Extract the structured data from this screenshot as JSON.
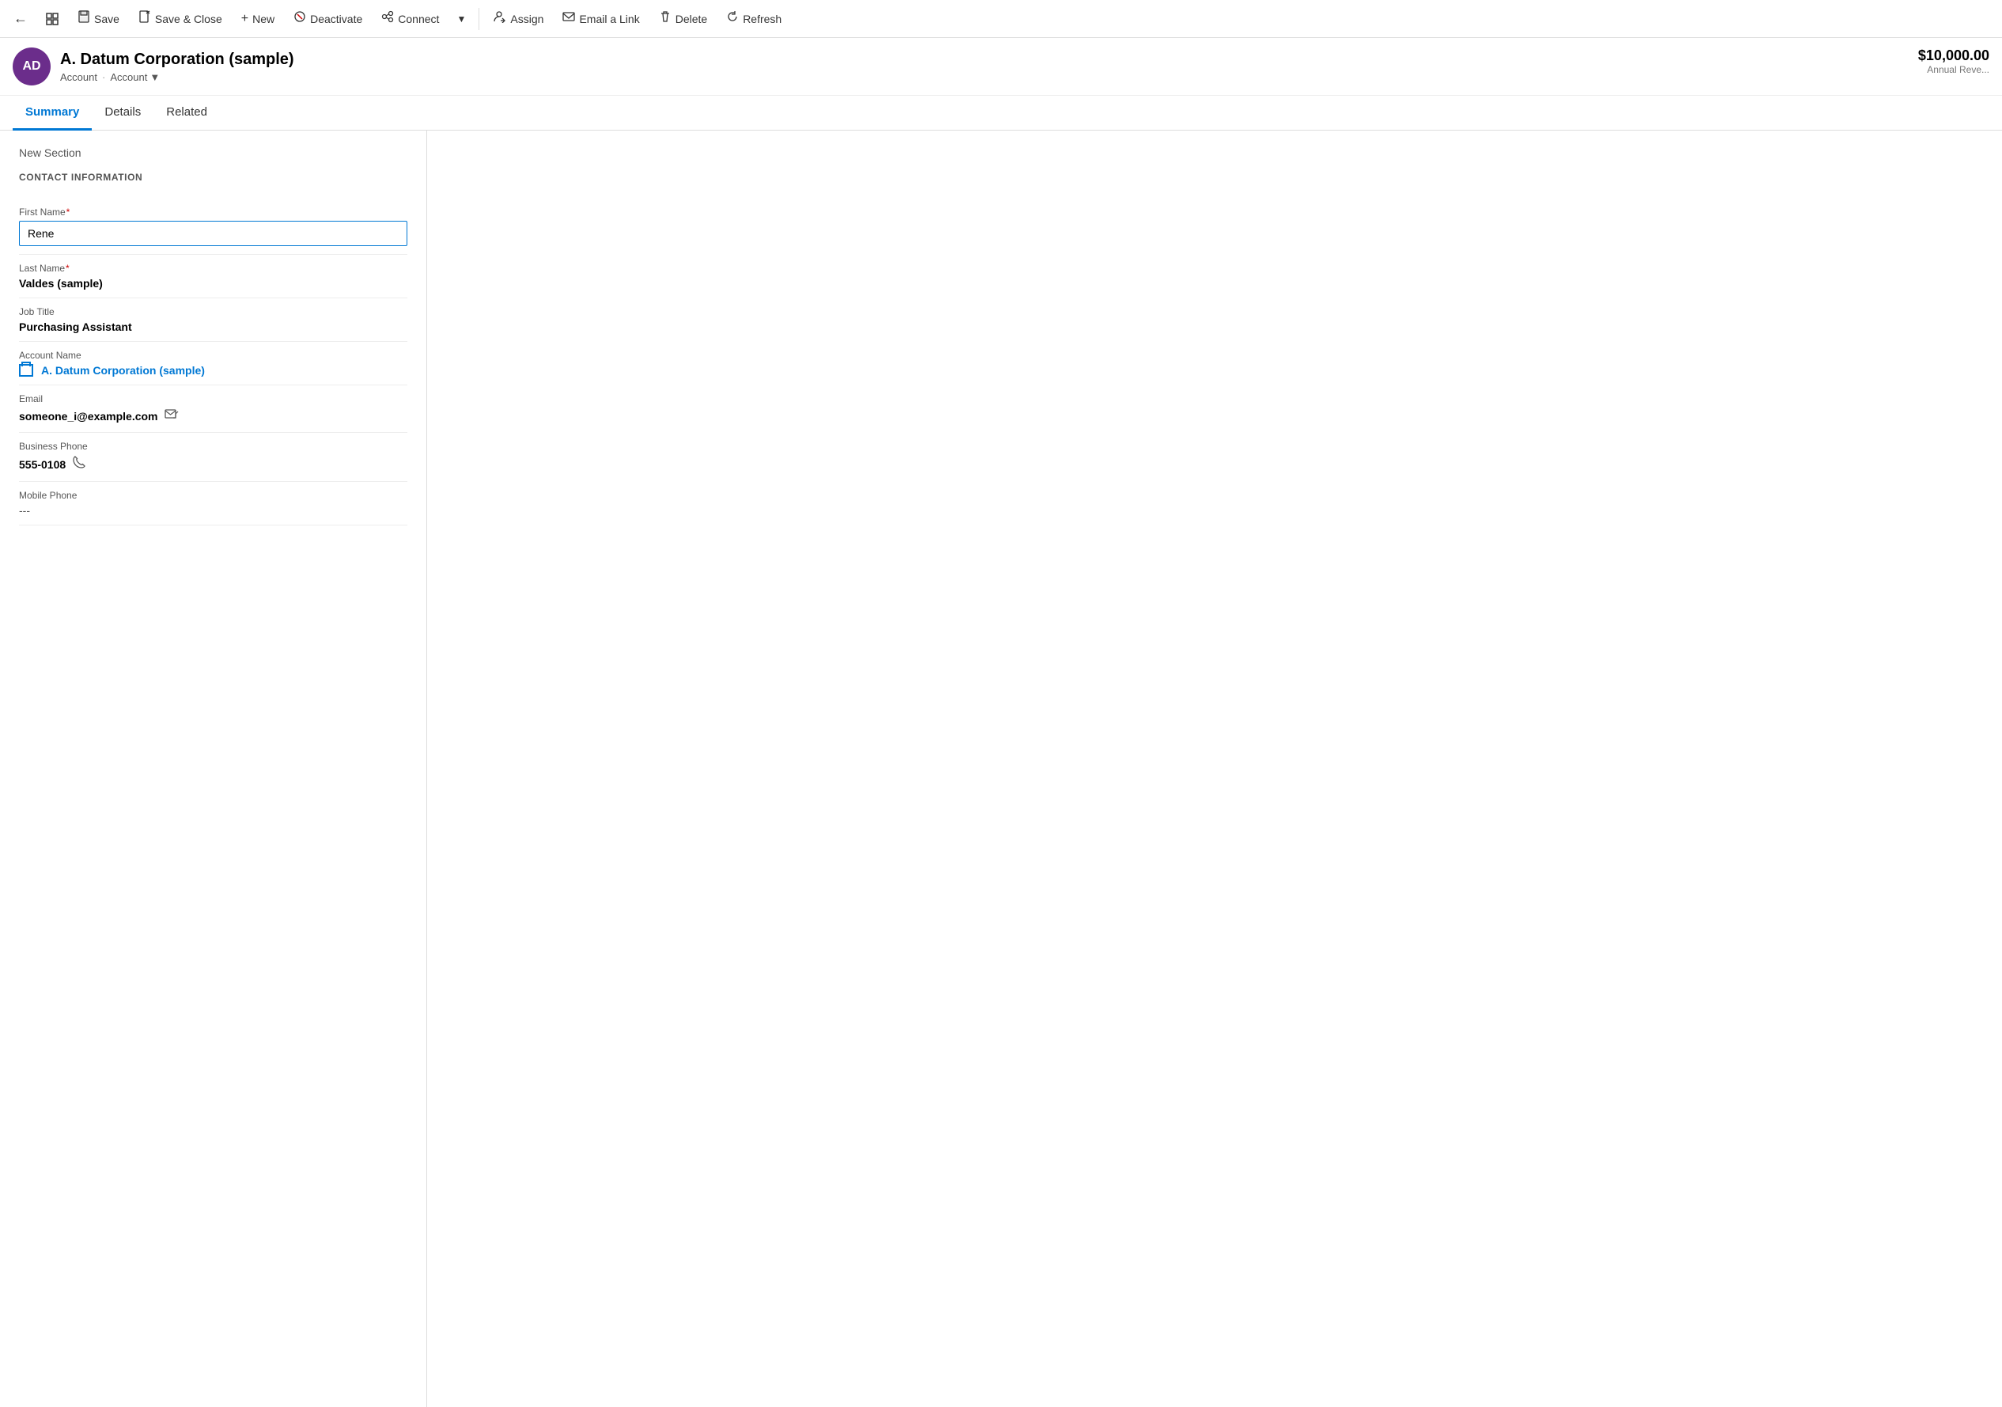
{
  "toolbar": {
    "back_label": "←",
    "grid_label": "⊞",
    "save_label": "Save",
    "save_close_label": "Save & Close",
    "new_label": "New",
    "deactivate_label": "Deactivate",
    "connect_label": "Connect",
    "more_label": "▾",
    "assign_label": "Assign",
    "email_link_label": "Email a Link",
    "delete_label": "Delete",
    "refresh_label": "Refresh"
  },
  "record": {
    "avatar_initials": "AD",
    "title": "A. Datum Corporation (sample)",
    "breadcrumb1": "Account",
    "breadcrumb2": "Account",
    "annual_revenue_value": "$10,000.00",
    "annual_revenue_label": "Annual Reve..."
  },
  "tabs": {
    "summary_label": "Summary",
    "details_label": "Details",
    "related_label": "Related"
  },
  "form": {
    "section_title": "New Section",
    "contact_info_header": "CONTACT INFORMATION",
    "first_name_label": "First Name",
    "first_name_value": "Rene",
    "last_name_label": "Last Name",
    "last_name_value": "Valdes (sample)",
    "job_title_label": "Job Title",
    "job_title_value": "Purchasing Assistant",
    "account_name_label": "Account Name",
    "account_name_value": "A. Datum Corporation (sample)",
    "email_label": "Email",
    "email_value": "someone_i@example.com",
    "business_phone_label": "Business Phone",
    "business_phone_value": "555-0108",
    "mobile_phone_label": "Mobile Phone",
    "mobile_phone_value": "---"
  }
}
